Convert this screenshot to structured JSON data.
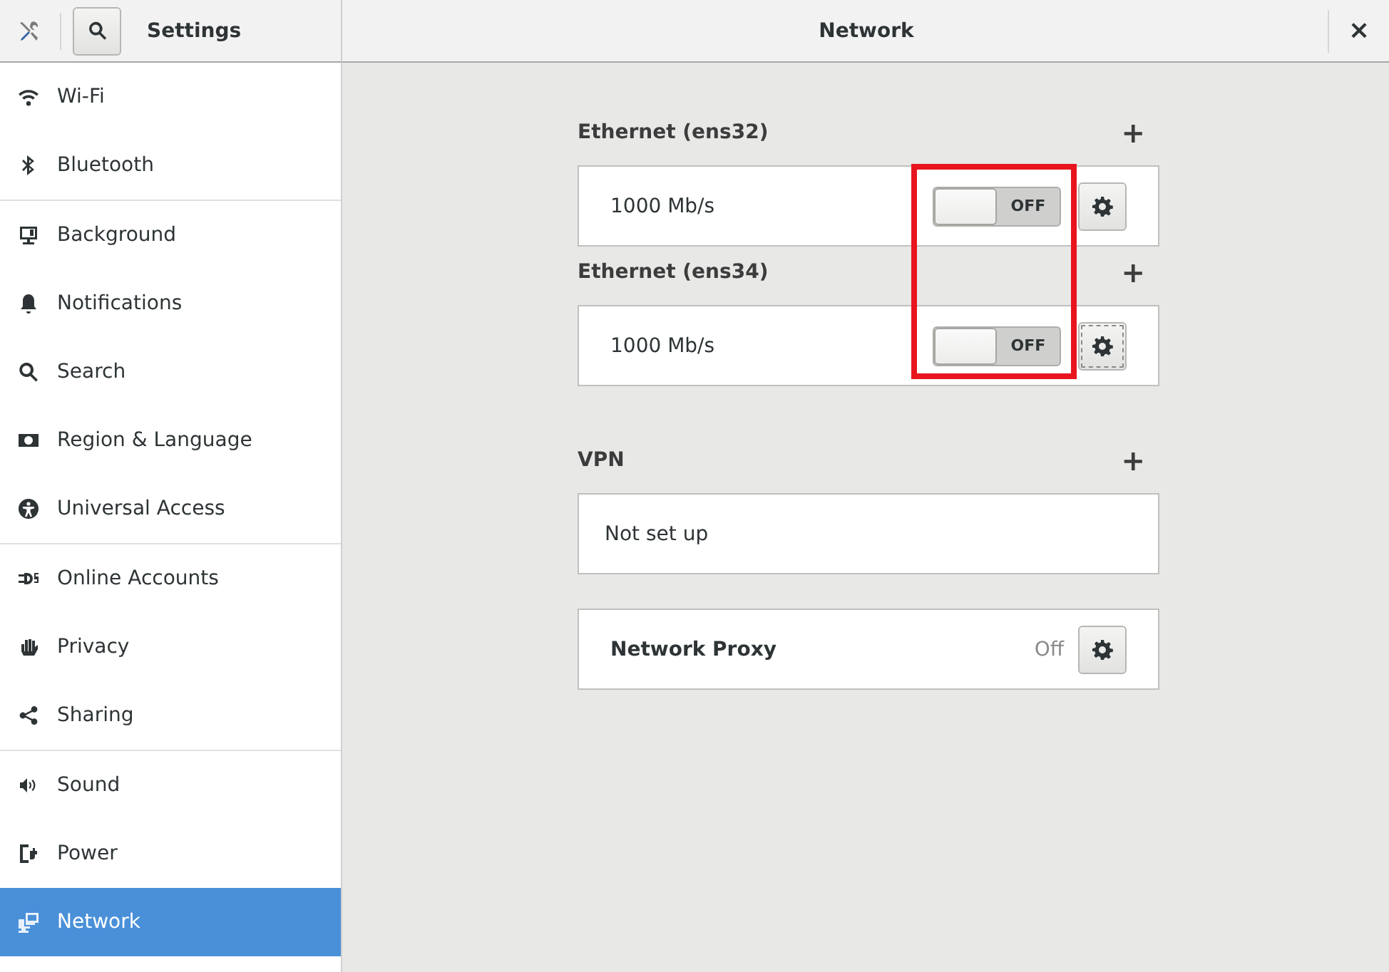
{
  "header": {
    "sidebar_title": "Settings",
    "title": "Network",
    "close": "×"
  },
  "sidebar": {
    "groups": [
      [
        {
          "label": "Wi-Fi",
          "selected": false
        },
        {
          "label": "Bluetooth",
          "selected": false
        }
      ],
      [
        {
          "label": "Background",
          "selected": false
        },
        {
          "label": "Notifications",
          "selected": false
        },
        {
          "label": "Search",
          "selected": false
        },
        {
          "label": "Region & Language",
          "selected": false
        },
        {
          "label": "Universal Access",
          "selected": false
        }
      ],
      [
        {
          "label": "Online Accounts",
          "selected": false
        },
        {
          "label": "Privacy",
          "selected": false
        },
        {
          "label": "Sharing",
          "selected": false
        }
      ],
      [
        {
          "label": "Sound",
          "selected": false
        },
        {
          "label": "Power",
          "selected": false
        },
        {
          "label": "Network",
          "selected": true
        }
      ]
    ]
  },
  "sections": [
    {
      "title": "Ethernet (ens32)",
      "add": "+",
      "kind": "device",
      "speed": "1000 Mb/s",
      "switch": {
        "on": false,
        "label": "OFF"
      },
      "focused": false
    },
    {
      "title": "Ethernet (ens34)",
      "add": "+",
      "kind": "device",
      "speed": "1000 Mb/s",
      "switch": {
        "on": false,
        "label": "OFF"
      },
      "focused": true
    },
    {
      "title": "VPN",
      "add": "+",
      "kind": "empty",
      "text": "Not set up"
    },
    {
      "kind": "proxy",
      "label": "Network Proxy",
      "status": "Off",
      "focused": false
    }
  ],
  "annotation": {
    "kind": "highlight-frame"
  }
}
